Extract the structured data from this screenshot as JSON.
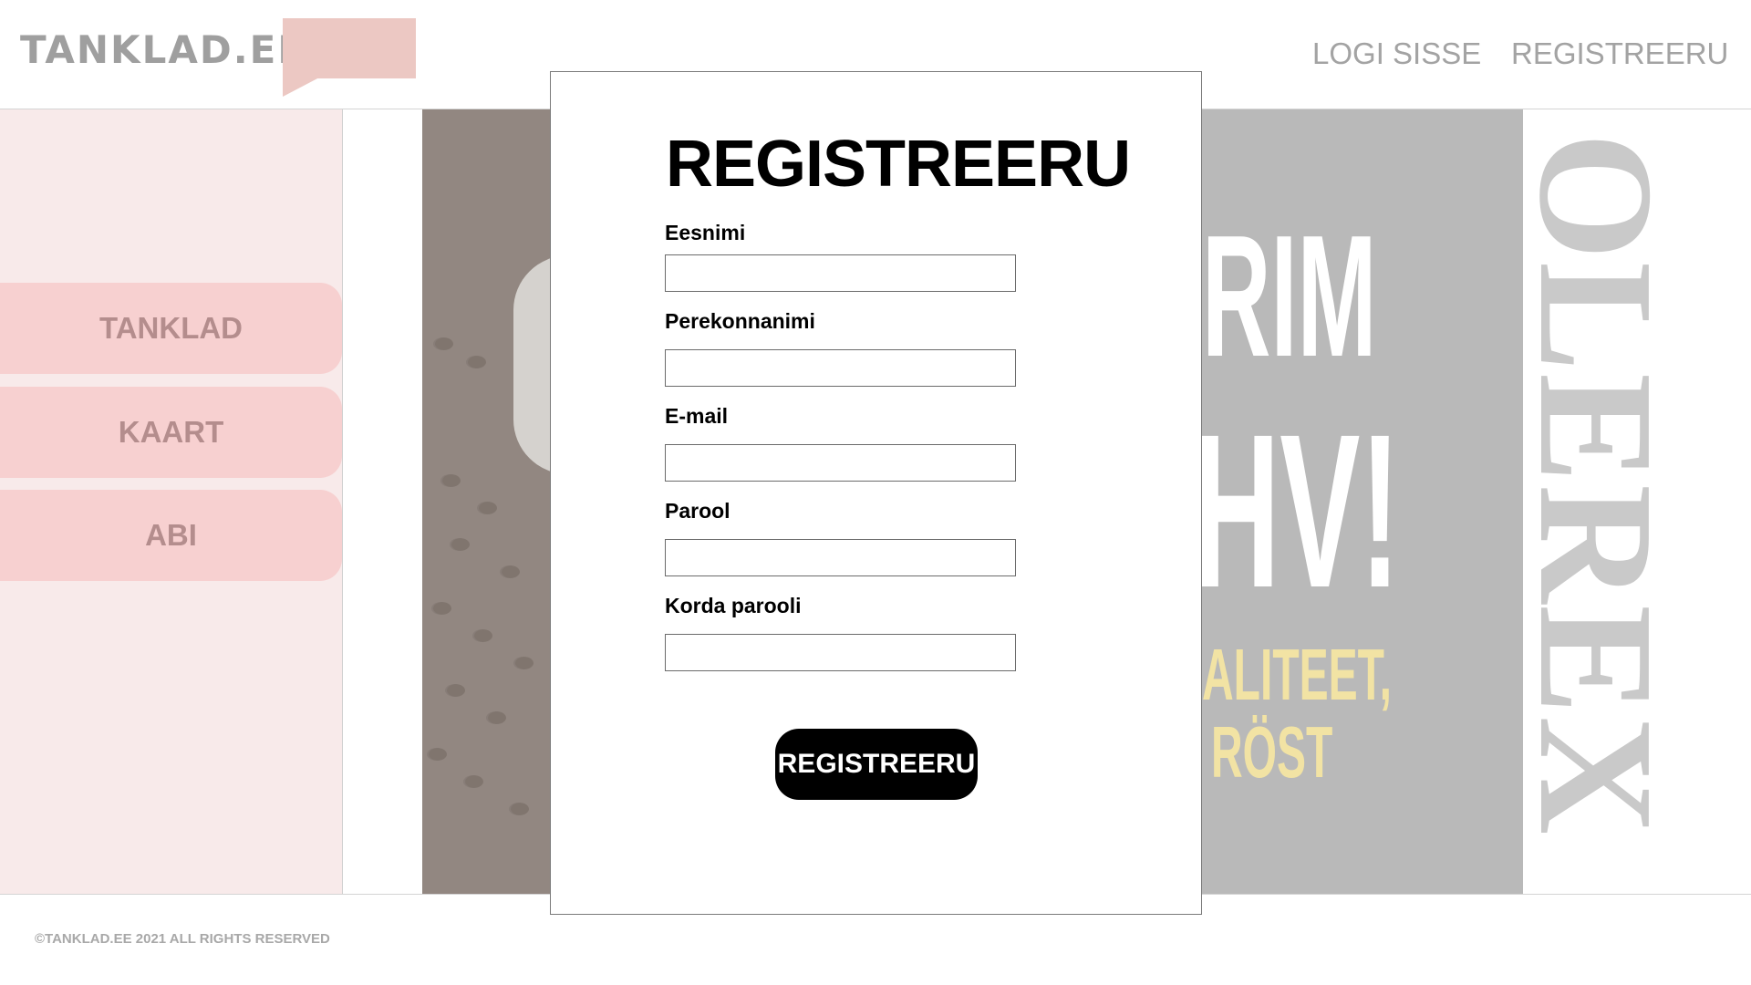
{
  "header": {
    "logo_text": "TANKLAD.EE",
    "nav": {
      "login_label": "LOGI SISSE",
      "register_label": "REGISTREERU"
    }
  },
  "sidebar": {
    "items": [
      {
        "label": "TANKLAD"
      },
      {
        "label": "KAART"
      },
      {
        "label": "ABI"
      }
    ]
  },
  "promo": {
    "line1": "RIM",
    "line2": "HV!",
    "line3": "ALITEET,",
    "line4": "RÖST",
    "brand_vertical": "OLEREX"
  },
  "modal": {
    "title": "REGISTREERU",
    "fields": [
      {
        "label": "Eesnimi",
        "value": ""
      },
      {
        "label": "Perekonnanimi",
        "value": ""
      },
      {
        "label": "E-mail",
        "value": ""
      },
      {
        "label": "Parool",
        "value": ""
      },
      {
        "label": "Korda parooli",
        "value": ""
      }
    ],
    "submit_label": "REGISTREERU"
  },
  "footer": {
    "copyright": "©TANKLAD.EE 2021 ALL RIGHTS RESERVED"
  },
  "colors": {
    "sidebar_bg": "#f8eaea",
    "sidebar_item_bg": "#f7d0d0",
    "logo_bubble": "#ecc8c3",
    "promo_bg": "#b9b9b9",
    "promo_accent": "#f2e3a4",
    "button_bg": "#000000"
  }
}
